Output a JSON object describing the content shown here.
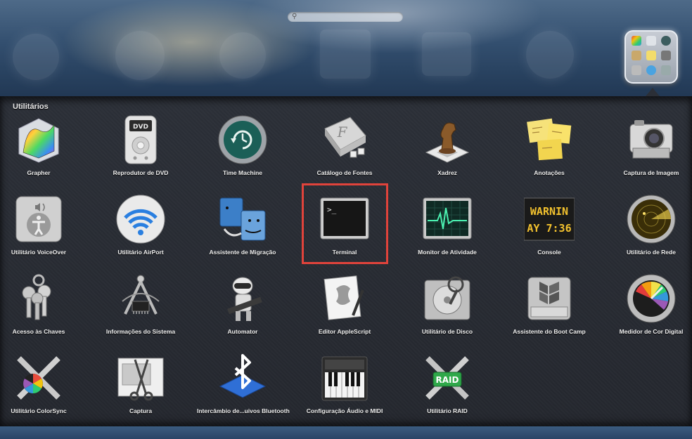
{
  "search": {
    "placeholder": ""
  },
  "folder": {
    "title": "Utilitários",
    "apps": [
      {
        "label": "Grapher",
        "icon": "grapher-icon"
      },
      {
        "label": "Reprodutor de DVD",
        "icon": "dvd-player-icon"
      },
      {
        "label": "Time Machine",
        "icon": "time-machine-icon"
      },
      {
        "label": "Catálogo de Fontes",
        "icon": "font-book-icon"
      },
      {
        "label": "Xadrez",
        "icon": "chess-icon"
      },
      {
        "label": "Anotações",
        "icon": "stickies-icon"
      },
      {
        "label": "Captura de Imagem",
        "icon": "image-capture-icon"
      },
      {
        "label": "Utilitário VoiceOver",
        "icon": "voiceover-icon"
      },
      {
        "label": "Utilitário AirPort",
        "icon": "airport-icon"
      },
      {
        "label": "Assistente de Migração",
        "icon": "migration-assistant-icon"
      },
      {
        "label": "Terminal",
        "icon": "terminal-icon"
      },
      {
        "label": "Monitor de Atividade",
        "icon": "activity-monitor-icon"
      },
      {
        "label": "Console",
        "icon": "console-icon"
      },
      {
        "label": "Utilitário de Rede",
        "icon": "network-utility-icon"
      },
      {
        "label": "Acesso às Chaves",
        "icon": "keychain-icon"
      },
      {
        "label": "Informações do Sistema",
        "icon": "system-information-icon"
      },
      {
        "label": "Automator",
        "icon": "automator-icon"
      },
      {
        "label": "Editor AppleScript",
        "icon": "applescript-icon"
      },
      {
        "label": "Utilitário de Disco",
        "icon": "disk-utility-icon"
      },
      {
        "label": "Assistente do Boot Camp",
        "icon": "boot-camp-icon"
      },
      {
        "label": "Medidor de Cor Digital",
        "icon": "color-meter-icon"
      },
      {
        "label": "Utilitário ColorSync",
        "icon": "colorsync-icon"
      },
      {
        "label": "Captura",
        "icon": "grab-icon"
      },
      {
        "label": "Intercâmbio de...uivos Bluetooth",
        "icon": "bluetooth-icon"
      },
      {
        "label": "Configuração Áudio e MIDI",
        "icon": "audio-midi-icon"
      },
      {
        "label": "Utilitário RAID",
        "icon": "raid-utility-icon"
      }
    ],
    "console_text": {
      "line1": "WARNIN",
      "line2": "AY 7:36"
    },
    "raid_text": "RAID"
  },
  "colors": {
    "highlight": "#e0433b",
    "panel": "#2a2d34"
  }
}
